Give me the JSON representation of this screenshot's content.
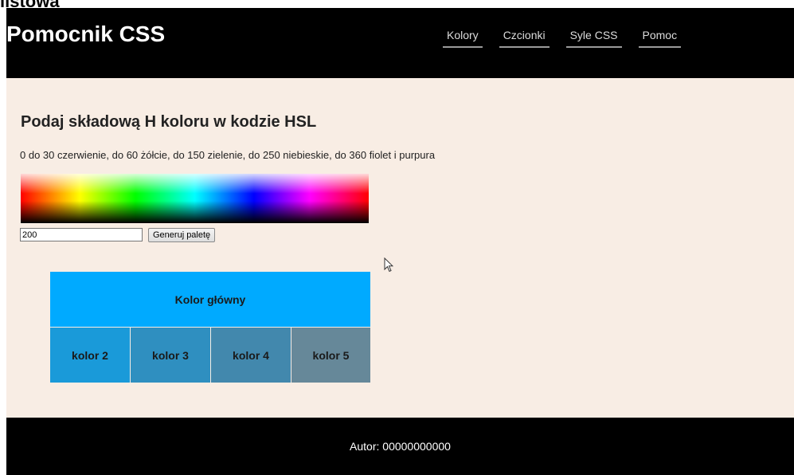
{
  "window": {
    "cut_title": "listowa"
  },
  "header": {
    "logo": "Pomocnik CSS",
    "nav": [
      {
        "label": "Kolory"
      },
      {
        "label": "Czcionki"
      },
      {
        "label": "Syle CSS"
      },
      {
        "label": "Pomoc"
      }
    ]
  },
  "main": {
    "heading": "Podaj składową H koloru w kodzie HSL",
    "hint": "0 do 30 czerwienie, do 60 żółcie, do 150 zielenie, do 250 niebieskie, do 360 fiolet i purpura",
    "input_value": "200",
    "button_label": "Generuj paletę",
    "palette": {
      "main": {
        "label": "Kolor główny",
        "color": "#00aaff"
      },
      "swatches": [
        {
          "label": "kolor 2",
          "color": "#1a9ad9"
        },
        {
          "label": "kolor 3",
          "color": "#2f8fc0"
        },
        {
          "label": "kolor 4",
          "color": "#4288ad"
        },
        {
          "label": "kolor 5",
          "color": "#668899"
        }
      ]
    }
  },
  "footer": {
    "author": "Autor: 00000000000"
  },
  "colors": {
    "header_bg": "#000000",
    "content_bg": "#f8ede4",
    "footer_bg": "#000000"
  },
  "icons": {
    "cursor": "mouse-pointer-icon"
  }
}
